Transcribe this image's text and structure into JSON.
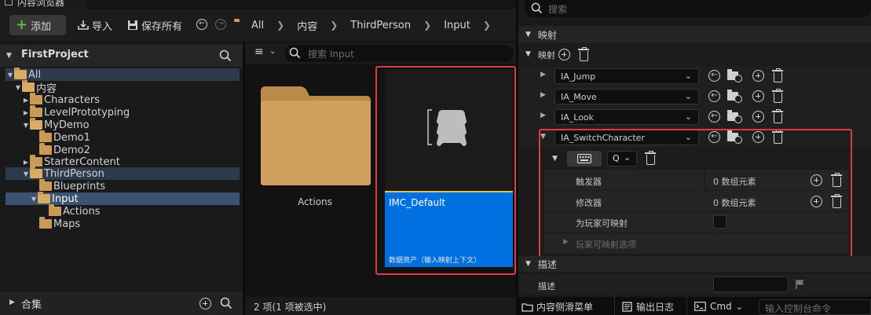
{
  "window": {
    "tab_title": "内容浏览器"
  },
  "toolbar": {
    "add_label": "添加",
    "import_label": "导入",
    "save_all_label": "保存所有",
    "breadcrumb": [
      "All",
      "内容",
      "ThirdPerson",
      "Input"
    ]
  },
  "sources": {
    "project": "FirstProject",
    "tree": [
      "All",
      "内容",
      "Characters",
      "LevelPrototyping",
      "MyDemo",
      "Demo1",
      "Demo2",
      "StarterContent",
      "ThirdPerson",
      "Blueprints",
      "Input",
      "Actions",
      "Maps"
    ],
    "collections_label": "合集"
  },
  "content": {
    "search_placeholder": "搜索 Input",
    "folder_label": "Actions",
    "asset_name": "IMC_Default",
    "asset_type": "数据资产（输入映射上下文）",
    "status": "2 项(1 项被选中)"
  },
  "details": {
    "search_placeholder": "搜索",
    "section_mappings": "映射",
    "mappings_label": "映射",
    "actions": [
      "IA_Jump",
      "IA_Move",
      "IA_Look",
      "IA_SwitchCharacter"
    ],
    "key_value": "Q",
    "triggers_label": "触发器",
    "triggers_value": "0 数组元素",
    "modifiers_label": "修改器",
    "modifiers_value": "0 数组元素",
    "player_mappable_label": "为玩家可映射",
    "player_mappable_options_label": "玩家可映射选项",
    "section_description": "描述",
    "description_label": "描述"
  },
  "bottom_bar": {
    "content_drawer": "内容侧滑菜单",
    "output_log": "输出日志",
    "cmd": "Cmd",
    "console_placeholder": "输入控制台命令"
  },
  "colors": {
    "accent_selected": "#0070e0",
    "highlight_box": "#e0384a",
    "folder": "#c89a55",
    "add_plus": "#5dbb4a"
  }
}
